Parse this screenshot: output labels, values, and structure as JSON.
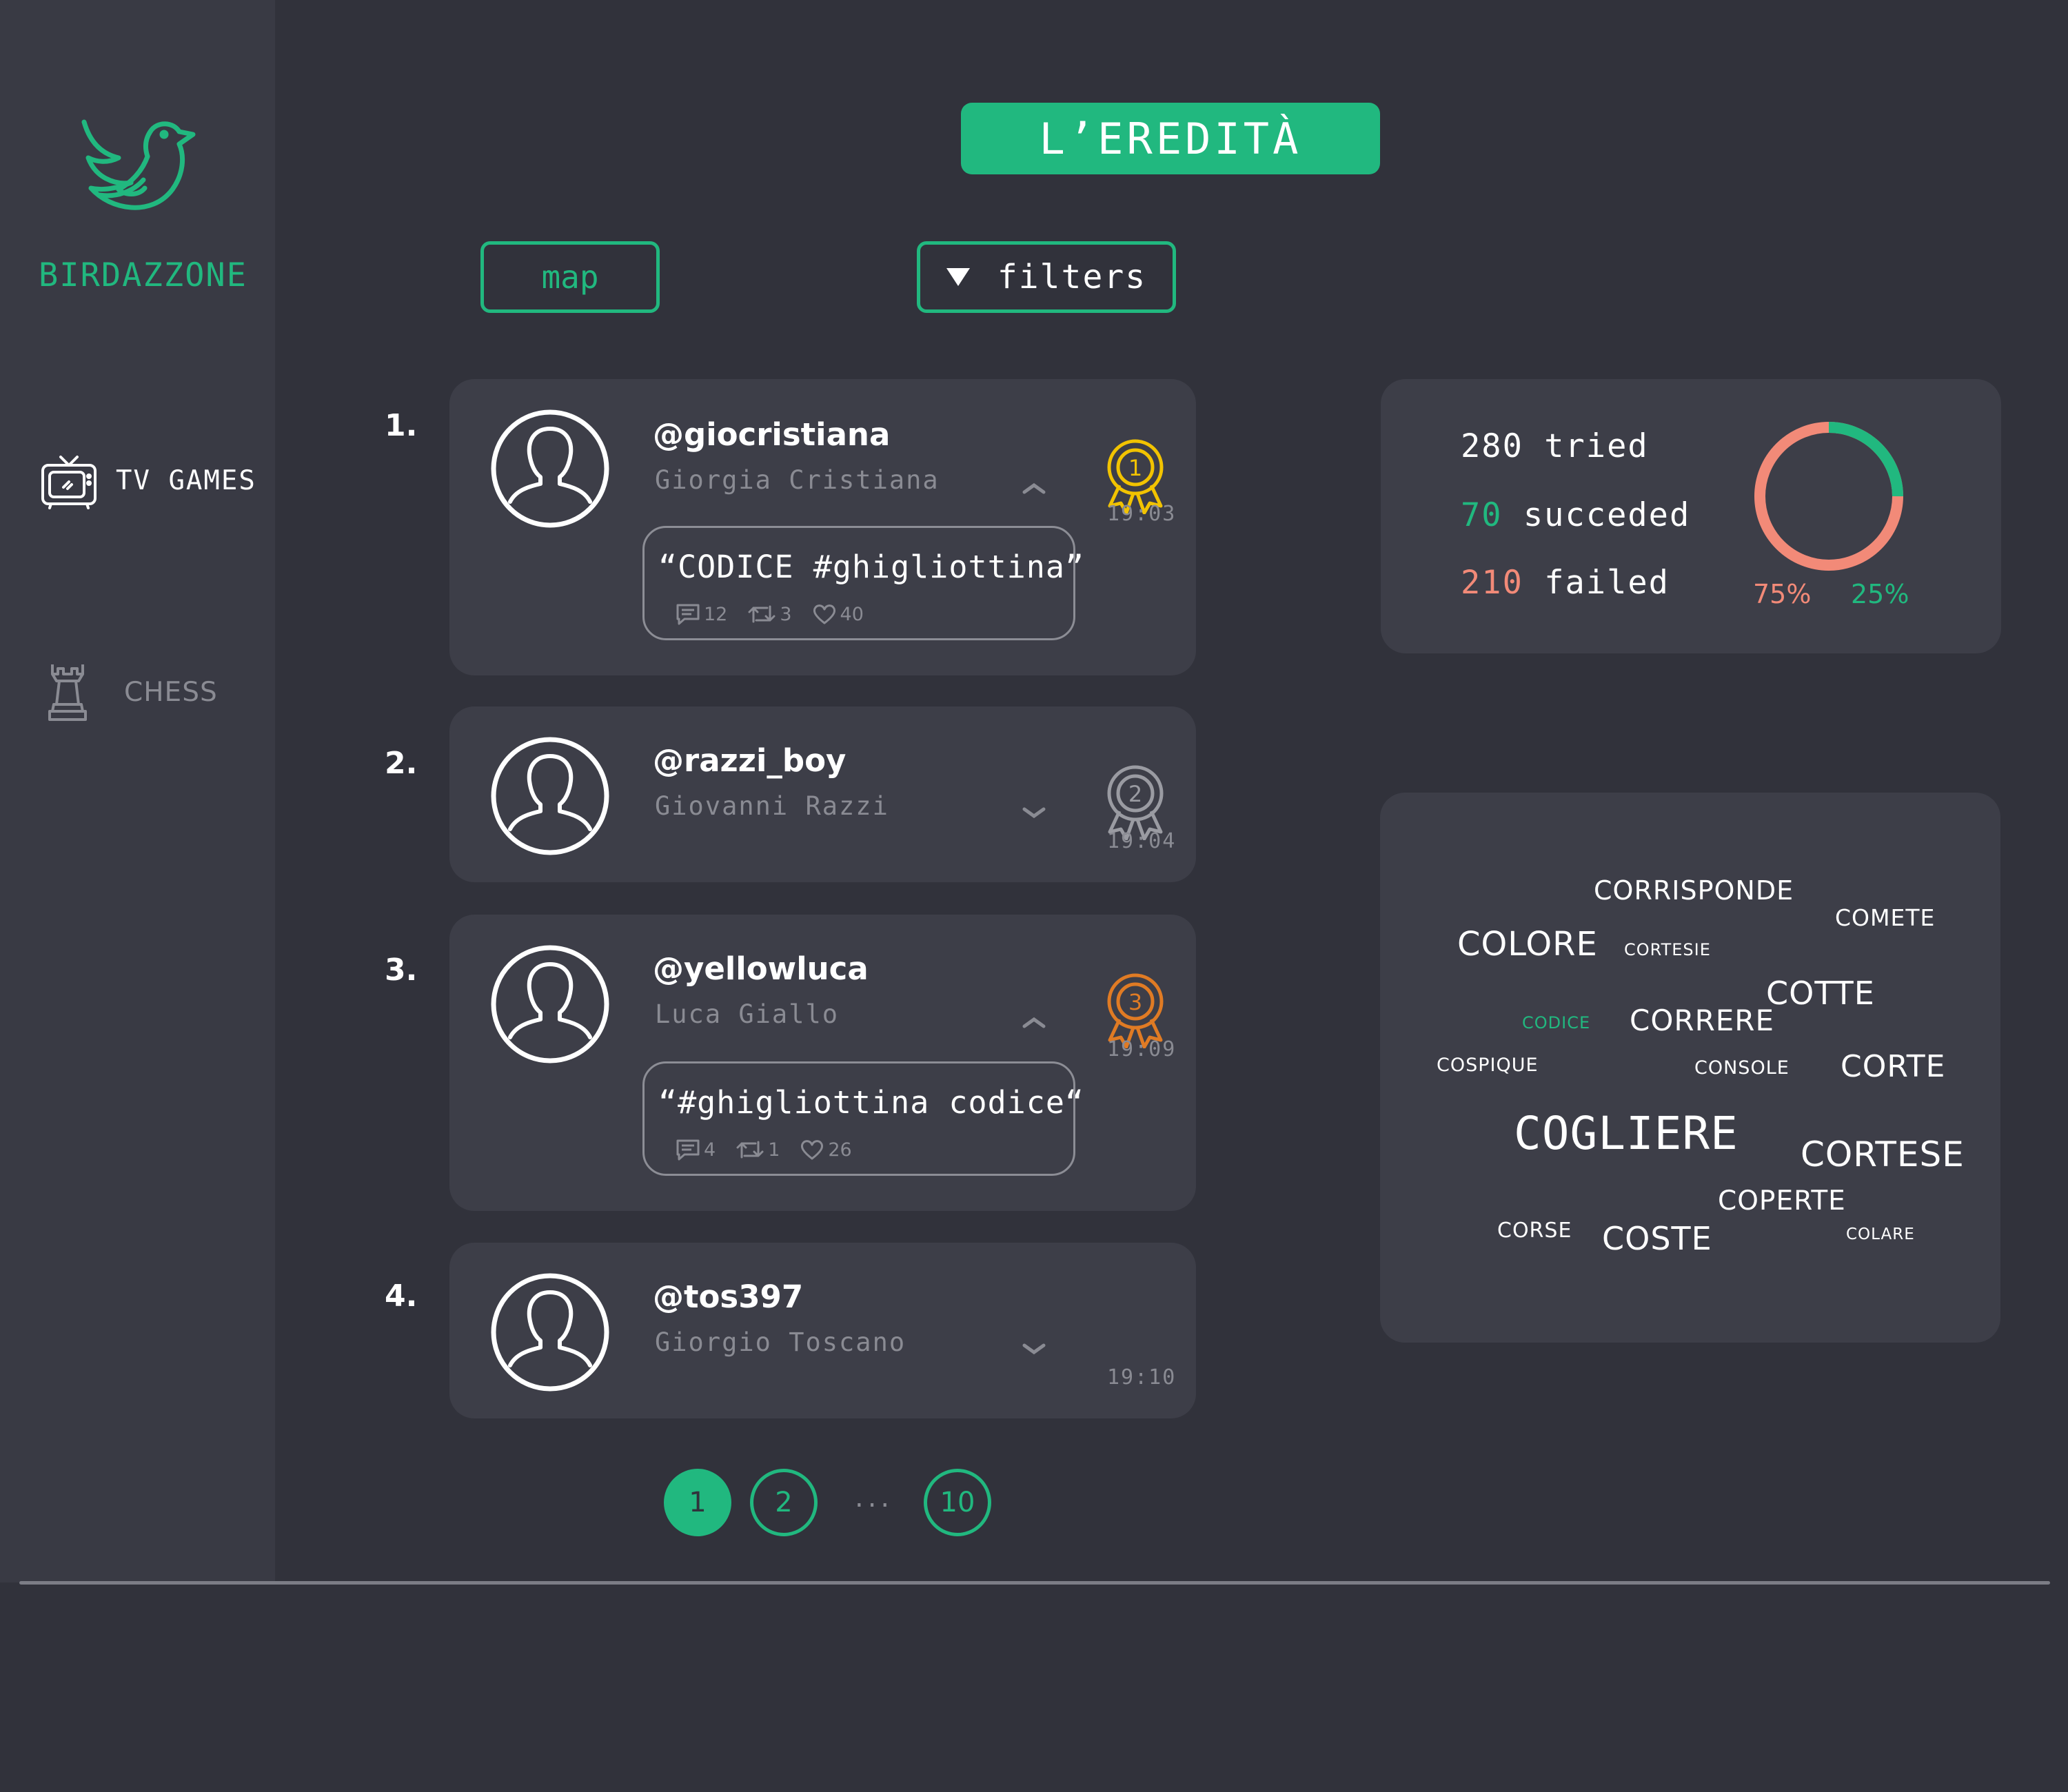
{
  "brand": {
    "name": "BIRDAZZONE"
  },
  "nav": {
    "items": [
      {
        "label": "TV GAMES",
        "icon": "tv-icon",
        "active": true
      },
      {
        "label": "CHESS",
        "icon": "chess-rook-icon",
        "active": false
      }
    ]
  },
  "header": {
    "title": "L’EREDITÀ",
    "map_label": "map",
    "filters_label": "filters"
  },
  "leaderboard": [
    {
      "rank": "1.",
      "handle": "@giocristiana",
      "name": "Giorgia Cristiana",
      "time": "19:03",
      "medal": "gold-medal-icon",
      "medal_number": "1",
      "expanded": true,
      "tweet": {
        "text": "“CODICE #ghigliottina”",
        "comments": "12",
        "retweets": "3",
        "likes": "40"
      }
    },
    {
      "rank": "2.",
      "handle": "@razzi_boy",
      "name": "Giovanni Razzi",
      "time": "19:04",
      "medal": "silver-medal-icon",
      "medal_number": "2",
      "expanded": false
    },
    {
      "rank": "3.",
      "handle": "@yellowluca",
      "name": "Luca Giallo",
      "time": "19:09",
      "medal": "bronze-medal-icon",
      "medal_number": "3",
      "expanded": true,
      "tweet": {
        "text": "“#ghigliottina codice“",
        "comments": "4",
        "retweets": "1",
        "likes": "26"
      }
    },
    {
      "rank": "4.",
      "handle": "@tos397",
      "name": "Giorgio Toscano",
      "time": "19:10",
      "expanded": false
    }
  ],
  "pagination": {
    "pages": [
      "1",
      "2",
      "10"
    ],
    "ellipsis": "...",
    "current": "1"
  },
  "summary": {
    "tried_count": "280",
    "tried_label": "tried",
    "succeded_count": "70",
    "succeded_label": "succeded",
    "failed_count": "210",
    "failed_label": "failed",
    "failed_pct_label": "75%",
    "succeded_pct_label": "25%",
    "failed_fraction": 0.75,
    "succeded_fraction": 0.25
  },
  "word_cloud": [
    {
      "text": "CORRISPONDE",
      "weight": 3
    },
    {
      "text": "COMETE",
      "weight": 2
    },
    {
      "text": "COLORE",
      "weight": 4
    },
    {
      "text": "CORTESIE",
      "weight": 1
    },
    {
      "text": "COTTE",
      "weight": 4
    },
    {
      "text": "CODICE",
      "weight": 1,
      "highlight": true
    },
    {
      "text": "CORRERE",
      "weight": 3
    },
    {
      "text": "COSPIQUE",
      "weight": 1
    },
    {
      "text": "CONSOLE",
      "weight": 1
    },
    {
      "text": "CORTE",
      "weight": 4
    },
    {
      "text": "COGLIERE",
      "weight": 6
    },
    {
      "text": "CORTESE",
      "weight": 4
    },
    {
      "text": "COPERTE",
      "weight": 3
    },
    {
      "text": "CORSE",
      "weight": 2
    },
    {
      "text": "COSTE",
      "weight": 4
    },
    {
      "text": "COLARE",
      "weight": 1
    }
  ],
  "colors": {
    "accent": "#21b87f",
    "failed": "#f28a78",
    "background": "#31323b",
    "card": "#3d3e48",
    "sidebar": "#393a44",
    "gold": "#f2c300",
    "silver": "#9a9ba2",
    "bronze": "#e07b24"
  }
}
